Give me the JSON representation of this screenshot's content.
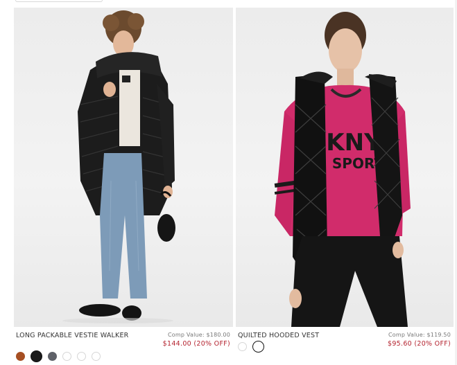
{
  "products": [
    {
      "name": "LONG PACKABLE VESTIE WALKER",
      "comp_value": "Comp Value: $180.00",
      "price": "$144.00 (20% OFF)",
      "swatch_colors": [
        "#a64f22",
        "#1a1a1a",
        "#5f6168",
        "#ffffff",
        "#ffffff",
        "#ffffff"
      ],
      "selected_swatch": 1
    },
    {
      "name": "QUILTED HOODED VEST",
      "comp_value": "Comp Value: $119.50",
      "price": "$95.60 (20% OFF)",
      "swatch_colors": [
        "#ffffff",
        "#ffffff"
      ],
      "selected_swatch": 1
    }
  ]
}
